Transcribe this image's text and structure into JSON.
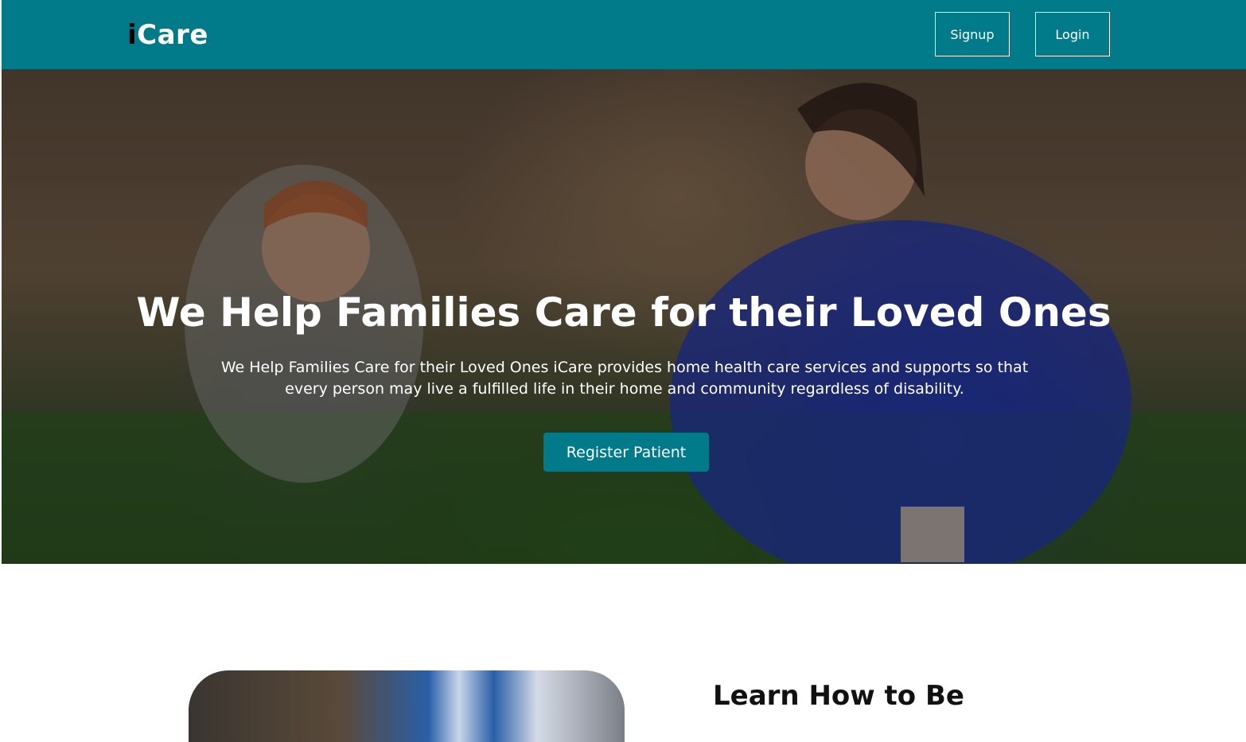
{
  "nav": {
    "brand_i": "i",
    "brand_rest": "Care",
    "signup_label": "Signup",
    "login_label": "Login",
    "color": "#017a8a"
  },
  "hero": {
    "title": "We Help Families Care for their Loved Ones",
    "subtitle": "We Help Families Care for their Loved Ones iCare provides home health care services and supports so that every person may live a fulfilled life in their home and community regardless of disability.",
    "register_label": "Register Patient",
    "background": "photo of caregiver in blue scrubs with smiling boy on grass"
  },
  "section": {
    "heading": "Learn How to Be"
  }
}
